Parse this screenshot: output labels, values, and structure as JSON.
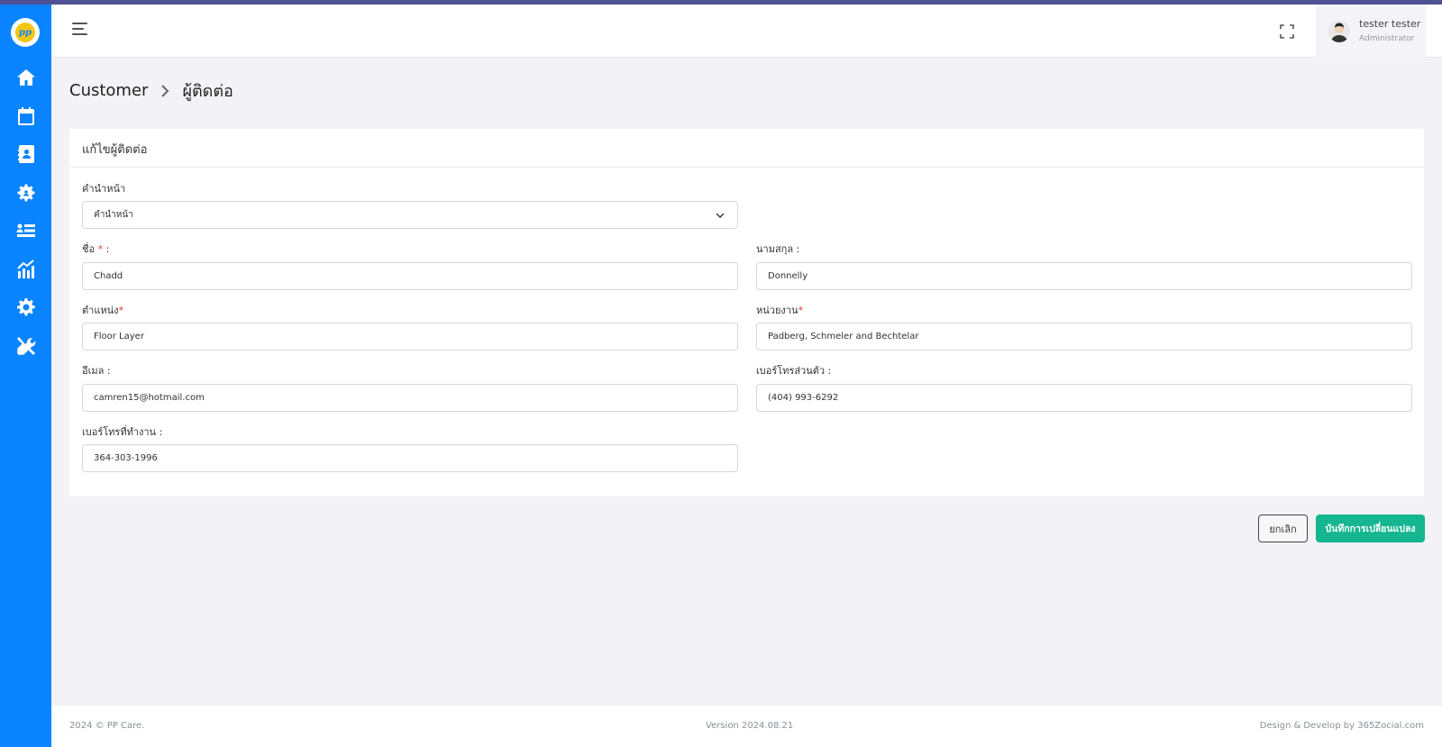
{
  "header": {
    "user_name": "tester tester",
    "user_role": "Administrator"
  },
  "breadcrumb": {
    "parent": "Customer",
    "current": "ผู้ติดต่อ"
  },
  "form": {
    "title": "แก้ไขผู้ติดต่อ",
    "prefix_label": "คำนำหน้า",
    "prefix_value": "คำนำหน้า",
    "first_name_label": "ชื่อ",
    "first_name_req": "*",
    "first_name_colon": ":",
    "first_name_value": "Chadd",
    "last_name_label": "นามสกุล :",
    "last_name_value": "Donnelly",
    "position_label": "ตำแหน่ง",
    "position_req": "*",
    "position_value": "Floor Layer",
    "department_label": "หน่วยงาน",
    "department_req": "*",
    "department_value": "Padberg, Schmeler and Bechtelar",
    "email_label": "อีเมล :",
    "email_value": "camren15@hotmail.com",
    "personal_phone_label": "เบอร์โทรส่วนตัว :",
    "personal_phone_value": "(404) 993-6292",
    "work_phone_label": "เบอร์โทรที่ทำงาน :",
    "work_phone_value": "364-303-1996"
  },
  "actions": {
    "cancel_label": "ยกเลิก",
    "save_label": "บันทึกการเปลี่ยนแปลง"
  },
  "footer": {
    "copyright": "2024 © PP Care.",
    "version": "Version 2024.08.21",
    "credit": "Design & Develop by 365Zocial.com"
  },
  "sidebar": {
    "items": [
      "home-icon",
      "calendar-billing-icon",
      "contacts-icon",
      "team-settings-icon",
      "list-icon",
      "chart-icon",
      "settings-icon",
      "tools-icon"
    ]
  },
  "colors": {
    "sidebar": "#0a84ff",
    "save_button": "#14b690",
    "required": "#e53935"
  }
}
